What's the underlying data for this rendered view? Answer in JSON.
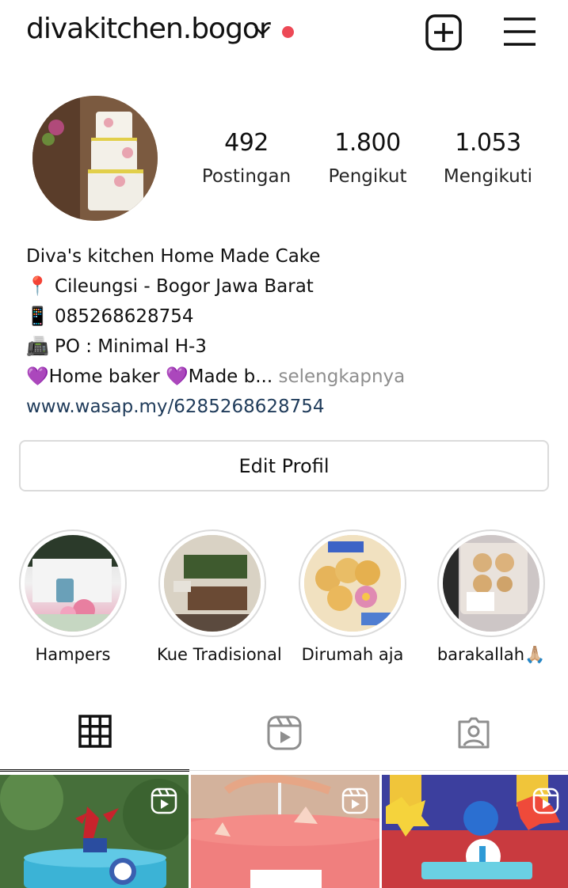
{
  "header": {
    "username": "divakitchen.bogor",
    "dropdown_icon": "chevron-down-icon",
    "notification_color": "#ed4956",
    "new_post_icon": "plus-square-icon",
    "menu_icon": "hamburger-menu-icon"
  },
  "stats": {
    "posts": {
      "count": "492",
      "label": "Postingan"
    },
    "followers": {
      "count": "1.800",
      "label": "Pengikut"
    },
    "following": {
      "count": "1.053",
      "label": "Mengikuti"
    }
  },
  "bio": {
    "name_line": "Diva's kitchen Home Made Cake",
    "location_emoji": "📍",
    "location": "Cileungsi - Bogor Jawa Barat",
    "phone_emoji": "📱",
    "phone": "085268628754",
    "po_emoji": "📠",
    "po": "PO : Minimal H-3",
    "heart_emoji": "💜",
    "line5_a": "Home baker ",
    "line5_b": "Made b...",
    "more": " selengkapnya",
    "link": "www.wasap.my/6285268628754"
  },
  "edit_profile_label": "Edit Profil",
  "highlights": [
    {
      "name": "Hampers"
    },
    {
      "name": "Kue Tradisional"
    },
    {
      "name": "Dirumah aja"
    },
    {
      "name": "barakallah🙏🏼"
    }
  ],
  "tabs": [
    {
      "icon": "grid-icon",
      "active": true
    },
    {
      "icon": "reels-icon",
      "active": false
    },
    {
      "icon": "tagged-icon",
      "active": false
    }
  ],
  "posts": [
    {
      "type": "reel"
    },
    {
      "type": "reel"
    },
    {
      "type": "reel"
    }
  ],
  "colors": {
    "text": "#262626",
    "link": "#1f3b5a",
    "muted": "#8e8e8e",
    "border": "#dbdbdb",
    "notification": "#ed4956"
  }
}
